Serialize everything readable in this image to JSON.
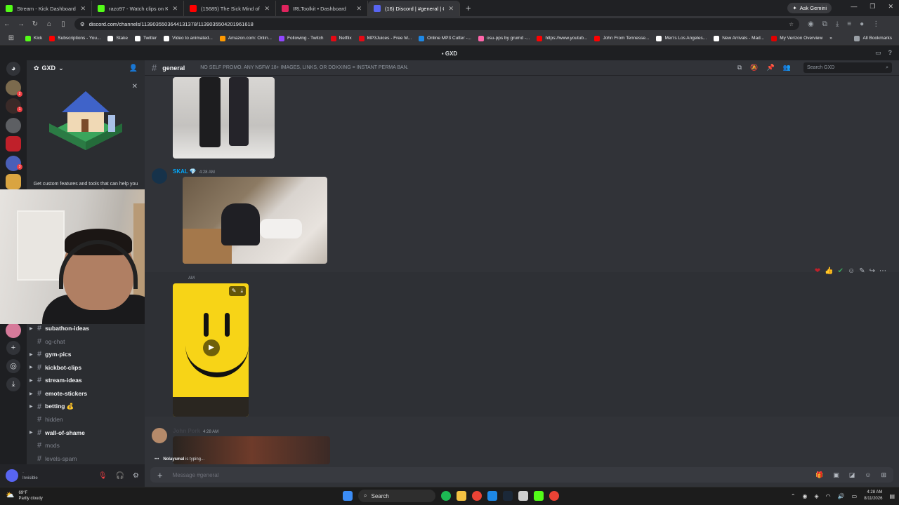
{
  "browser": {
    "tabs": [
      {
        "title": "Stream - Kick Dashboard",
        "color": "#53fc18"
      },
      {
        "title": "razo97 - Watch clips on Kick",
        "color": "#53fc18"
      },
      {
        "title": "(15685) The Sick Mind of EDP",
        "color": "#ff0000"
      },
      {
        "title": "IRLToolkit • Dashboard",
        "color": "#e0245e"
      },
      {
        "title": "(16) Discord | #general | GXD",
        "color": "#5865f2"
      }
    ],
    "new_tab": "+",
    "ask_gemini": "Ask Gemini",
    "url": "discord.com/channels/1139035503644131378/1139035504201961618",
    "bookmarks": [
      {
        "label": "Kick",
        "color": "#53fc18"
      },
      {
        "label": "Subscriptions - You...",
        "color": "#ff0000"
      },
      {
        "label": "Stake",
        "color": "#ffffff"
      },
      {
        "label": "Twitter",
        "color": "#ffffff"
      },
      {
        "label": "Video to animated...",
        "color": "#ffffff"
      },
      {
        "label": "Amazon.com: Onlin...",
        "color": "#ff9900"
      },
      {
        "label": "Following - Twitch",
        "color": "#9146ff"
      },
      {
        "label": "Netflix",
        "color": "#e50914"
      },
      {
        "label": "MP3Juices - Free M...",
        "color": "#e50914"
      },
      {
        "label": "Online MP3 Cutter -...",
        "color": "#1e88e5"
      },
      {
        "label": "osu-pps by grumd -...",
        "color": "#ff66aa"
      },
      {
        "label": "https://www.youtub...",
        "color": "#ff0000"
      },
      {
        "label": "John From Tennesse...",
        "color": "#ff0000"
      },
      {
        "label": "Men's Los Angeles...",
        "color": "#ffffff"
      },
      {
        "label": "New Arrivals - Mad...",
        "color": "#ffffff"
      },
      {
        "label": "My Verizon Overview",
        "color": "#e00000"
      }
    ],
    "all_bookmarks": "All Bookmarks"
  },
  "discord": {
    "window_title": "GXD",
    "server_name": "GXD",
    "promo_text": "Get custom features and tools that can help you run your community.",
    "channels": [
      {
        "name": "subathon-ideas",
        "muted": false,
        "caret": true
      },
      {
        "name": "og-chat",
        "muted": true,
        "caret": false
      },
      {
        "name": "gym-pics",
        "muted": false,
        "caret": true
      },
      {
        "name": "kickbot-clips",
        "muted": false,
        "caret": true
      },
      {
        "name": "stream-ideas",
        "muted": false,
        "caret": true
      },
      {
        "name": "emote-stickers",
        "muted": false,
        "caret": true
      },
      {
        "name": "betting 💰",
        "muted": false,
        "caret": true
      },
      {
        "name": "hidden",
        "muted": true,
        "caret": false
      },
      {
        "name": "wall-of-shame",
        "muted": false,
        "caret": true
      },
      {
        "name": "mods",
        "muted": true,
        "caret": false
      },
      {
        "name": "levels-spam",
        "muted": true,
        "caret": false
      }
    ],
    "user_status": "Invisible",
    "channel_name": "general",
    "topic": "NO SELF PROMO. ANY NSFW 18+ IMAGES, LINKS, OR DOXXING = INSTANT PERMA BAN.",
    "search_placeholder": "Search GXD",
    "messages": [
      {
        "author": "SKAL 💎",
        "time": "4:28 AM",
        "color": "#00a8fc"
      },
      {
        "author": "",
        "time": "AM",
        "color": "#dbdee1"
      },
      {
        "author": "John Pork",
        "time": "4:28 AM",
        "color": "#dbdee1"
      }
    ],
    "typing_user": "Nolaysmal",
    "typing_text": "is typing...",
    "composer_placeholder": "Message #general"
  },
  "taskbar": {
    "temp": "69°F",
    "weather": "Partly cloudy",
    "search": "Search",
    "time": "4:28 AM",
    "date": "8/11/2026"
  }
}
